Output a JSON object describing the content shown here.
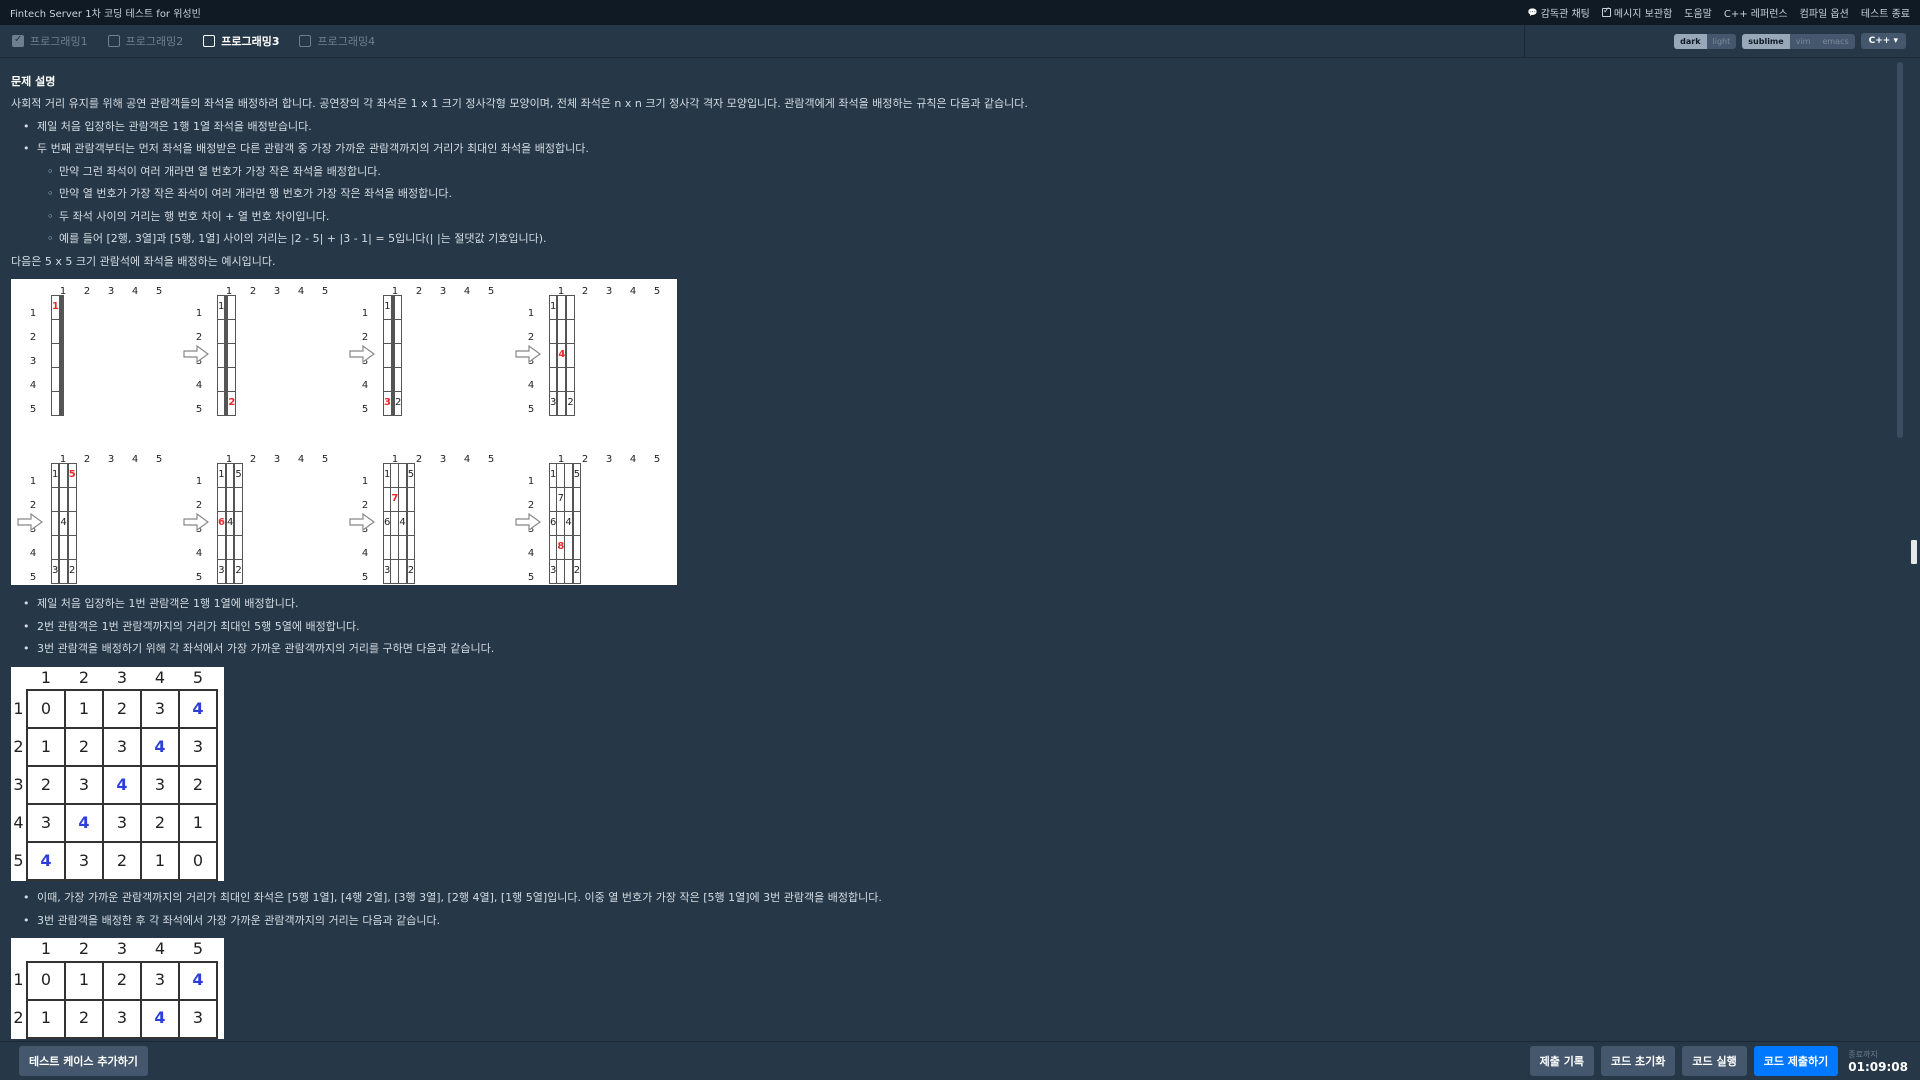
{
  "top": {
    "title": "Fintech Server 1차 코딩 테스트 for 위성빈",
    "menu": [
      {
        "icon": "chat-icon",
        "label": "감독관 채팅"
      },
      {
        "icon": "checkbox-icon",
        "label": "메시지 보관함"
      },
      {
        "icon": "",
        "label": "도움말"
      },
      {
        "icon": "",
        "label": "C++ 레퍼런스"
      },
      {
        "icon": "",
        "label": "컴파일 옵션"
      },
      {
        "icon": "",
        "label": "테스트 종료"
      }
    ]
  },
  "tabs": [
    {
      "label": "프로그래밍1",
      "state": "done"
    },
    {
      "label": "프로그래밍2",
      "state": "todo"
    },
    {
      "label": "프로그래밍3",
      "state": "active"
    },
    {
      "label": "프로그래밍4",
      "state": "todo"
    }
  ],
  "editor": {
    "themes": [
      "dark",
      "light"
    ],
    "active_theme": "dark",
    "keymaps": [
      "sublime",
      "vim",
      "emacs"
    ],
    "active_keymap": "sublime",
    "language": "C++"
  },
  "problem": {
    "heading": "문제 설명",
    "intro": "사회적 거리 유지를 위해 공연 관람객들의 좌석을 배정하려 합니다. 공연장의 각 좌석은 1 x 1 크기 정사각형 모양이며, 전체 좌석은 n x n 크기 정사각 격자 모양입니다. 관람객에게 좌석을 배정하는 규칙은 다음과 같습니다.",
    "rules": [
      "제일 처음 입장하는 관람객은 1행 1열 좌석을 배정받습니다.",
      "두 번째 관람객부터는 먼저 좌석을 배정받은 다른 관람객 중 가장 가까운 관람객까지의 거리가 최대인 좌석을 배정합니다."
    ],
    "subrules": [
      "만약 그런 좌석이 여러 개라면 열 번호가 가장 작은 좌석을 배정합니다.",
      "만약 열 번호가 가장 작은 좌석이 여러 개라면 행 번호가 가장 작은 좌석을 배정합니다.",
      "두 좌석 사이의 거리는 행 번호 차이 + 열 번호 차이입니다.",
      "예를 들어 [2행, 3열]과 [5행, 1열] 사이의 거리는 |2 - 5| + |3 - 1| = 5입니다(| |는 절댓값 기호입니다)."
    ],
    "example_intro": "다음은 5 x 5 크기 관람석에 좌석을 배정하는 예시입니다.",
    "after_figure": [
      "제일 처음 입장하는 1번 관람객은 1행 1열에 배정합니다.",
      "2번 관람객은 1번 관람객까지의 거리가 최대인 5행 5열에 배정합니다.",
      "3번 관람객을 배정하기 위해 각 좌석에서 가장 가까운 관람객까지의 거리를 구하면 다음과 같습니다."
    ],
    "after_table1": [
      "이때, 가장 가까운 관람객까지의 거리가 최대인 좌석은 [5행 1열], [4행 2열], [3행 3열], [2행 4열], [1행 5열]입니다. 이중 열 번호가 가장 작은 [5행 1열]에 3번 관람객을 배정합니다.",
      "3번 관람객을 배정한 후 각 좌석에서 가장 가까운 관람객까지의 거리는 다음과 같습니다."
    ]
  },
  "figure": {
    "col_labels": [
      "1",
      "2",
      "3",
      "4",
      "5"
    ],
    "row_labels": [
      "1",
      "2",
      "3",
      "4",
      "5"
    ],
    "grids": [
      {
        "cells": [
          [
            "1",
            "",
            "",
            "",
            ""
          ],
          [
            "",
            "",
            "",
            "",
            ""
          ],
          [
            "",
            "",
            "",
            "",
            ""
          ],
          [
            "",
            "",
            "",
            "",
            ""
          ],
          [
            "",
            "",
            "",
            "",
            ""
          ]
        ],
        "new": [
          0,
          0
        ]
      },
      {
        "cells": [
          [
            "1",
            "",
            "",
            "",
            ""
          ],
          [
            "",
            "",
            "",
            "",
            ""
          ],
          [
            "",
            "",
            "",
            "",
            ""
          ],
          [
            "",
            "",
            "",
            "",
            ""
          ],
          [
            "",
            "",
            "",
            "",
            "2"
          ]
        ],
        "new": [
          4,
          4
        ]
      },
      {
        "cells": [
          [
            "1",
            "",
            "",
            "",
            ""
          ],
          [
            "",
            "",
            "",
            "",
            ""
          ],
          [
            "",
            "",
            "",
            "",
            ""
          ],
          [
            "",
            "",
            "",
            "",
            ""
          ],
          [
            "3",
            "",
            "",
            "",
            "2"
          ]
        ],
        "new": [
          4,
          0
        ]
      },
      {
        "cells": [
          [
            "1",
            "",
            "",
            "",
            ""
          ],
          [
            "",
            "",
            "",
            "",
            ""
          ],
          [
            "",
            "",
            "4",
            "",
            ""
          ],
          [
            "",
            "",
            "",
            "",
            ""
          ],
          [
            "3",
            "",
            "",
            "",
            "2"
          ]
        ],
        "new": [
          2,
          2
        ]
      },
      {
        "cells": [
          [
            "1",
            "",
            "",
            "",
            "5"
          ],
          [
            "",
            "",
            "",
            "",
            ""
          ],
          [
            "",
            "",
            "4",
            "",
            ""
          ],
          [
            "",
            "",
            "",
            "",
            ""
          ],
          [
            "3",
            "",
            "",
            "",
            "2"
          ]
        ],
        "new": [
          0,
          4
        ]
      },
      {
        "cells": [
          [
            "1",
            "",
            "",
            "",
            "5"
          ],
          [
            "",
            "",
            "",
            "",
            ""
          ],
          [
            "6",
            "",
            "4",
            "",
            ""
          ],
          [
            "",
            "",
            "",
            "",
            ""
          ],
          [
            "3",
            "",
            "",
            "",
            "2"
          ]
        ],
        "new": [
          2,
          0
        ]
      },
      {
        "cells": [
          [
            "1",
            "",
            "",
            "",
            "5"
          ],
          [
            "",
            "7",
            "",
            "",
            ""
          ],
          [
            "6",
            "",
            "4",
            "",
            ""
          ],
          [
            "",
            "",
            "",
            "",
            ""
          ],
          [
            "3",
            "",
            "",
            "",
            "2"
          ]
        ],
        "new": [
          1,
          1
        ]
      },
      {
        "cells": [
          [
            "1",
            "",
            "",
            "",
            "5"
          ],
          [
            "",
            "7",
            "",
            "",
            ""
          ],
          [
            "6",
            "",
            "4",
            "",
            ""
          ],
          [
            "",
            "8",
            "",
            "",
            ""
          ],
          [
            "3",
            "",
            "",
            "",
            "2"
          ]
        ],
        "new": [
          3,
          1
        ]
      }
    ]
  },
  "dist_table_1": {
    "cols": [
      "1",
      "2",
      "3",
      "4",
      "5"
    ],
    "rows": [
      "1",
      "2",
      "3",
      "4",
      "5"
    ],
    "cells": [
      [
        "0",
        "1",
        "2",
        "3",
        "4"
      ],
      [
        "1",
        "2",
        "3",
        "4",
        "3"
      ],
      [
        "2",
        "3",
        "4",
        "3",
        "2"
      ],
      [
        "3",
        "4",
        "3",
        "2",
        "1"
      ],
      [
        "4",
        "3",
        "2",
        "1",
        "0"
      ]
    ],
    "highlight": [
      [
        0,
        4
      ],
      [
        1,
        3
      ],
      [
        2,
        2
      ],
      [
        3,
        1
      ],
      [
        4,
        0
      ]
    ]
  },
  "dist_table_2": {
    "cols": [
      "1",
      "2",
      "3",
      "4",
      "5"
    ],
    "rows": [
      "1",
      "2"
    ],
    "cells": [
      [
        "0",
        "1",
        "2",
        "3",
        "4"
      ],
      [
        "1",
        "2",
        "3",
        "4",
        "3"
      ]
    ],
    "highlight": [
      [
        0,
        4
      ],
      [
        1,
        3
      ]
    ]
  },
  "bottom": {
    "add_testcase": "테스트 케이스 추가하기",
    "history": "제출 기록",
    "reset": "코드 초기화",
    "run": "코드 실행",
    "submit": "코드 제출하기",
    "timer_label": "종료까지",
    "timer_value": "01:09:08"
  },
  "colors": {
    "bg": "#263747",
    "topbar": "#0f1a25",
    "primary": "#0078ff",
    "red": "#e82a2a",
    "blue": "#2c3fd8"
  }
}
